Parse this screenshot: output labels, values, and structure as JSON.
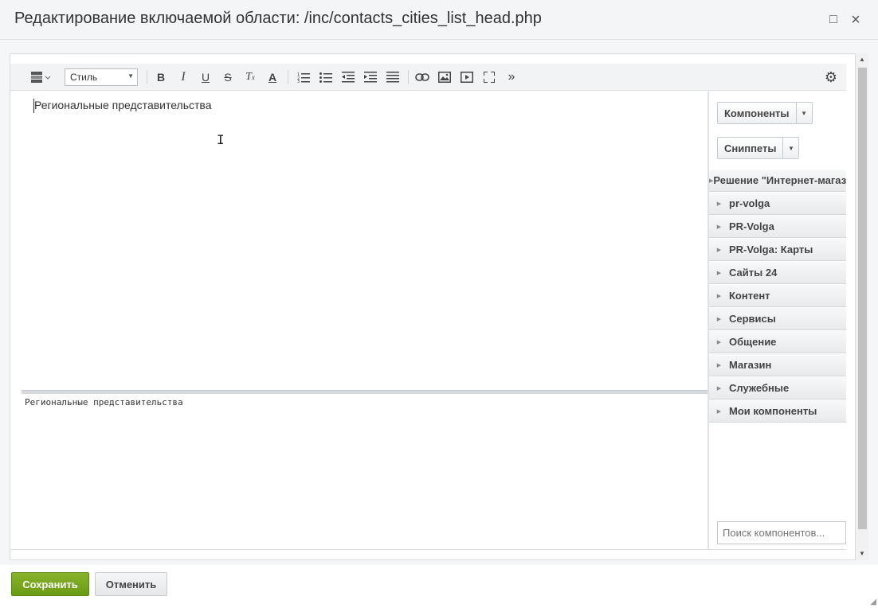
{
  "window": {
    "title": "Редактирование включаемой области: /inc/contacts_cities_list_head.php",
    "maximize_icon": "□",
    "close_icon": "×"
  },
  "toolbar": {
    "style_select_value": "Стиль",
    "icons": [
      "template-icon",
      "bold-icon",
      "italic-icon",
      "underline-icon",
      "strikethrough-icon",
      "remove-format-icon",
      "font-color-icon",
      "ordered-list-icon",
      "unordered-list-icon",
      "outdent-icon",
      "indent-icon",
      "align-icon",
      "link-icon",
      "image-icon",
      "video-icon",
      "fullscreen-icon",
      "more-icon",
      "settings-icon"
    ]
  },
  "editor": {
    "content": "Региональные представительства",
    "code_content": "Региональные представительства"
  },
  "side_panel": {
    "components_button": "Компоненты",
    "snippets_button": "Сниппеты",
    "groups": [
      "Решение \"Интернет-магазин\"",
      "pr-volga",
      "PR-Volga",
      "PR-Volga: Карты",
      "Сайты 24",
      "Контент",
      "Сервисы",
      "Общение",
      "Магазин",
      "Служебные",
      "Мои компоненты"
    ],
    "search_placeholder": "Поиск компонентов..."
  },
  "footer": {
    "save_label": "Сохранить",
    "cancel_label": "Отменить"
  },
  "colors": {
    "save_button": "#7aa81f",
    "titlebar": "#f4f5f6",
    "panel_group": "#eceef0"
  }
}
